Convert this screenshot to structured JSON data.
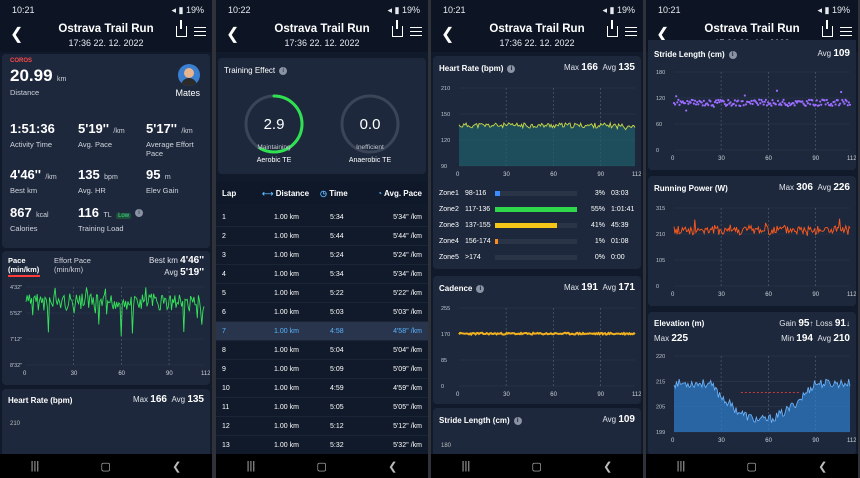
{
  "panels": [
    {
      "time": "10:21",
      "battery": "19%"
    },
    {
      "time": "10:22",
      "battery": "19%"
    },
    {
      "time": "10:21",
      "battery": "19%"
    },
    {
      "time": "10:21",
      "battery": "19%"
    }
  ],
  "header": {
    "title": "Ostrava Trail Run",
    "subtitle": "17:36 22. 12. 2022"
  },
  "summary": {
    "brand": "COROS",
    "distance": "20.99",
    "distance_unit": "km",
    "distance_label": "Distance",
    "user": "Mates",
    "stats": [
      {
        "value": "1:51:36",
        "unit": "",
        "label": "Activity Time"
      },
      {
        "value": "5'19''",
        "unit": "/km",
        "label": "Avg. Pace"
      },
      {
        "value": "5'17''",
        "unit": "/km",
        "label": "Average Effort Pace"
      },
      {
        "value": "4'46''",
        "unit": "/km",
        "label": "Best km"
      },
      {
        "value": "135",
        "unit": "bpm",
        "label": "Avg. HR"
      },
      {
        "value": "95",
        "unit": "m",
        "label": "Elev Gain"
      },
      {
        "value": "867",
        "unit": "kcal",
        "label": "Calories"
      },
      {
        "value": "116",
        "unit": "TL",
        "badge": "Low",
        "label": "Training Load"
      }
    ]
  },
  "pace_chart": {
    "tab1": "Pace",
    "tab1b": "(min/km)",
    "tab2": "Effort Pace",
    "tab2b": "(min/km)",
    "best_label": "Best km",
    "best": "4'46''",
    "avg_label": "Avg",
    "avg": "5'19''",
    "yticks": [
      "4'32''",
      "5'52''",
      "7'12''",
      "8'32''"
    ],
    "xticks": [
      "0",
      "30",
      "60",
      "90",
      "112"
    ]
  },
  "hr_header": {
    "title": "Heart Rate (bpm)",
    "max_label": "Max",
    "max": "166",
    "avg_label": "Avg",
    "avg": "135",
    "ytop": "210"
  },
  "training_effect": {
    "title": "Training Effect",
    "aerobic": {
      "value": "2.9",
      "status": "Maintaining",
      "label": "Aerobic TE",
      "fraction": 0.58
    },
    "anaerobic": {
      "value": "0.0",
      "status": "Inefficient",
      "label": "Anaerobic TE",
      "fraction": 0
    }
  },
  "laps": {
    "headers": {
      "lap": "Lap",
      "distance": "Distance",
      "time": "Time",
      "pace": "Avg. Pace"
    },
    "rows": [
      {
        "lap": "1",
        "distance": "1.00 km",
        "time": "5:34",
        "pace": "5'34'' /km"
      },
      {
        "lap": "2",
        "distance": "1.00 km",
        "time": "5:44",
        "pace": "5'44'' /km"
      },
      {
        "lap": "3",
        "distance": "1.00 km",
        "time": "5:24",
        "pace": "5'24'' /km"
      },
      {
        "lap": "4",
        "distance": "1.00 km",
        "time": "5:34",
        "pace": "5'34'' /km"
      },
      {
        "lap": "5",
        "distance": "1.00 km",
        "time": "5:22",
        "pace": "5'22'' /km"
      },
      {
        "lap": "6",
        "distance": "1.00 km",
        "time": "5:03",
        "pace": "5'03'' /km"
      },
      {
        "lap": "7",
        "distance": "1.00 km",
        "time": "4:58",
        "pace": "4'58'' /km"
      },
      {
        "lap": "8",
        "distance": "1.00 km",
        "time": "5:04",
        "pace": "5'04'' /km"
      },
      {
        "lap": "9",
        "distance": "1.00 km",
        "time": "5:09",
        "pace": "5'09'' /km"
      },
      {
        "lap": "10",
        "distance": "1.00 km",
        "time": "4:59",
        "pace": "4'59'' /km"
      },
      {
        "lap": "11",
        "distance": "1.00 km",
        "time": "5:05",
        "pace": "5'05'' /km"
      },
      {
        "lap": "12",
        "distance": "1.00 km",
        "time": "5:12",
        "pace": "5'12'' /km"
      },
      {
        "lap": "13",
        "distance": "1.00 km",
        "time": "5:32",
        "pace": "5'32'' /km"
      }
    ]
  },
  "hr_chart": {
    "title": "Heart Rate (bpm)",
    "max_label": "Max",
    "max": "166",
    "avg_label": "Avg",
    "avg": "135",
    "yticks": [
      "210",
      "150",
      "120",
      "90"
    ],
    "xticks": [
      "0",
      "30",
      "60",
      "90",
      "112"
    ]
  },
  "zones": [
    {
      "name": "Zone1",
      "range": "98-116",
      "pct": "3%",
      "time": "03:03",
      "fraction": 0.03,
      "color": "#3a8cff"
    },
    {
      "name": "Zone2",
      "range": "117-136",
      "pct": "55%",
      "time": "1:01:41",
      "fraction": 0.55,
      "color": "#2fd84a"
    },
    {
      "name": "Zone3",
      "range": "137-155",
      "pct": "41%",
      "time": "45:39",
      "fraction": 0.41,
      "color": "#f5c518"
    },
    {
      "name": "Zone4",
      "range": "156-174",
      "pct": "1%",
      "time": "01:08",
      "fraction": 0.01,
      "color": "#ff8a1e"
    },
    {
      "name": "Zone5",
      "range": ">174",
      "pct": "0%",
      "time": "0:00",
      "fraction": 0,
      "color": "#ff3b3b"
    }
  ],
  "cadence": {
    "title": "Cadence",
    "max_label": "Max",
    "max": "191",
    "avg_label": "Avg",
    "avg": "171",
    "yticks": [
      "255",
      "170",
      "85",
      "0"
    ],
    "xticks": [
      "0",
      "30",
      "60",
      "90",
      "112"
    ]
  },
  "stride_header": {
    "title": "Stride Length (cm)",
    "avg_label": "Avg",
    "avg": "109",
    "ytop": "180"
  },
  "stride": {
    "title": "Stride Length (cm)",
    "avg_label": "Avg",
    "avg": "109",
    "yticks": [
      "180",
      "120",
      "60",
      "0"
    ],
    "xticks": [
      "0",
      "30",
      "60",
      "90",
      "112"
    ]
  },
  "power": {
    "title": "Running Power (W)",
    "max_label": "Max",
    "max": "306",
    "avg_label": "Avg",
    "avg": "226",
    "yticks": [
      "315",
      "210",
      "105",
      "0"
    ],
    "xticks": [
      "0",
      "30",
      "60",
      "90",
      "112"
    ]
  },
  "elevation": {
    "title": "Elevation (m)",
    "gain_label": "Gain",
    "gain": "95",
    "loss_label": "Loss",
    "loss": "91",
    "max_label": "Max",
    "max": "225",
    "min_label": "Min",
    "min": "194",
    "avg_label": "Avg",
    "avg": "210",
    "yticks": [
      "220",
      "215",
      "205",
      "199"
    ],
    "xticks": [
      "0",
      "30",
      "60",
      "90",
      "112"
    ]
  },
  "colors": {
    "pace": "#35e35a",
    "hr_low": "#2a8f6e",
    "hr_line": "#c8d84a",
    "cadence": "#f0b020",
    "stride": "#9a6cff",
    "power": "#ff5a1e",
    "elevation": "#2f86d8"
  }
}
